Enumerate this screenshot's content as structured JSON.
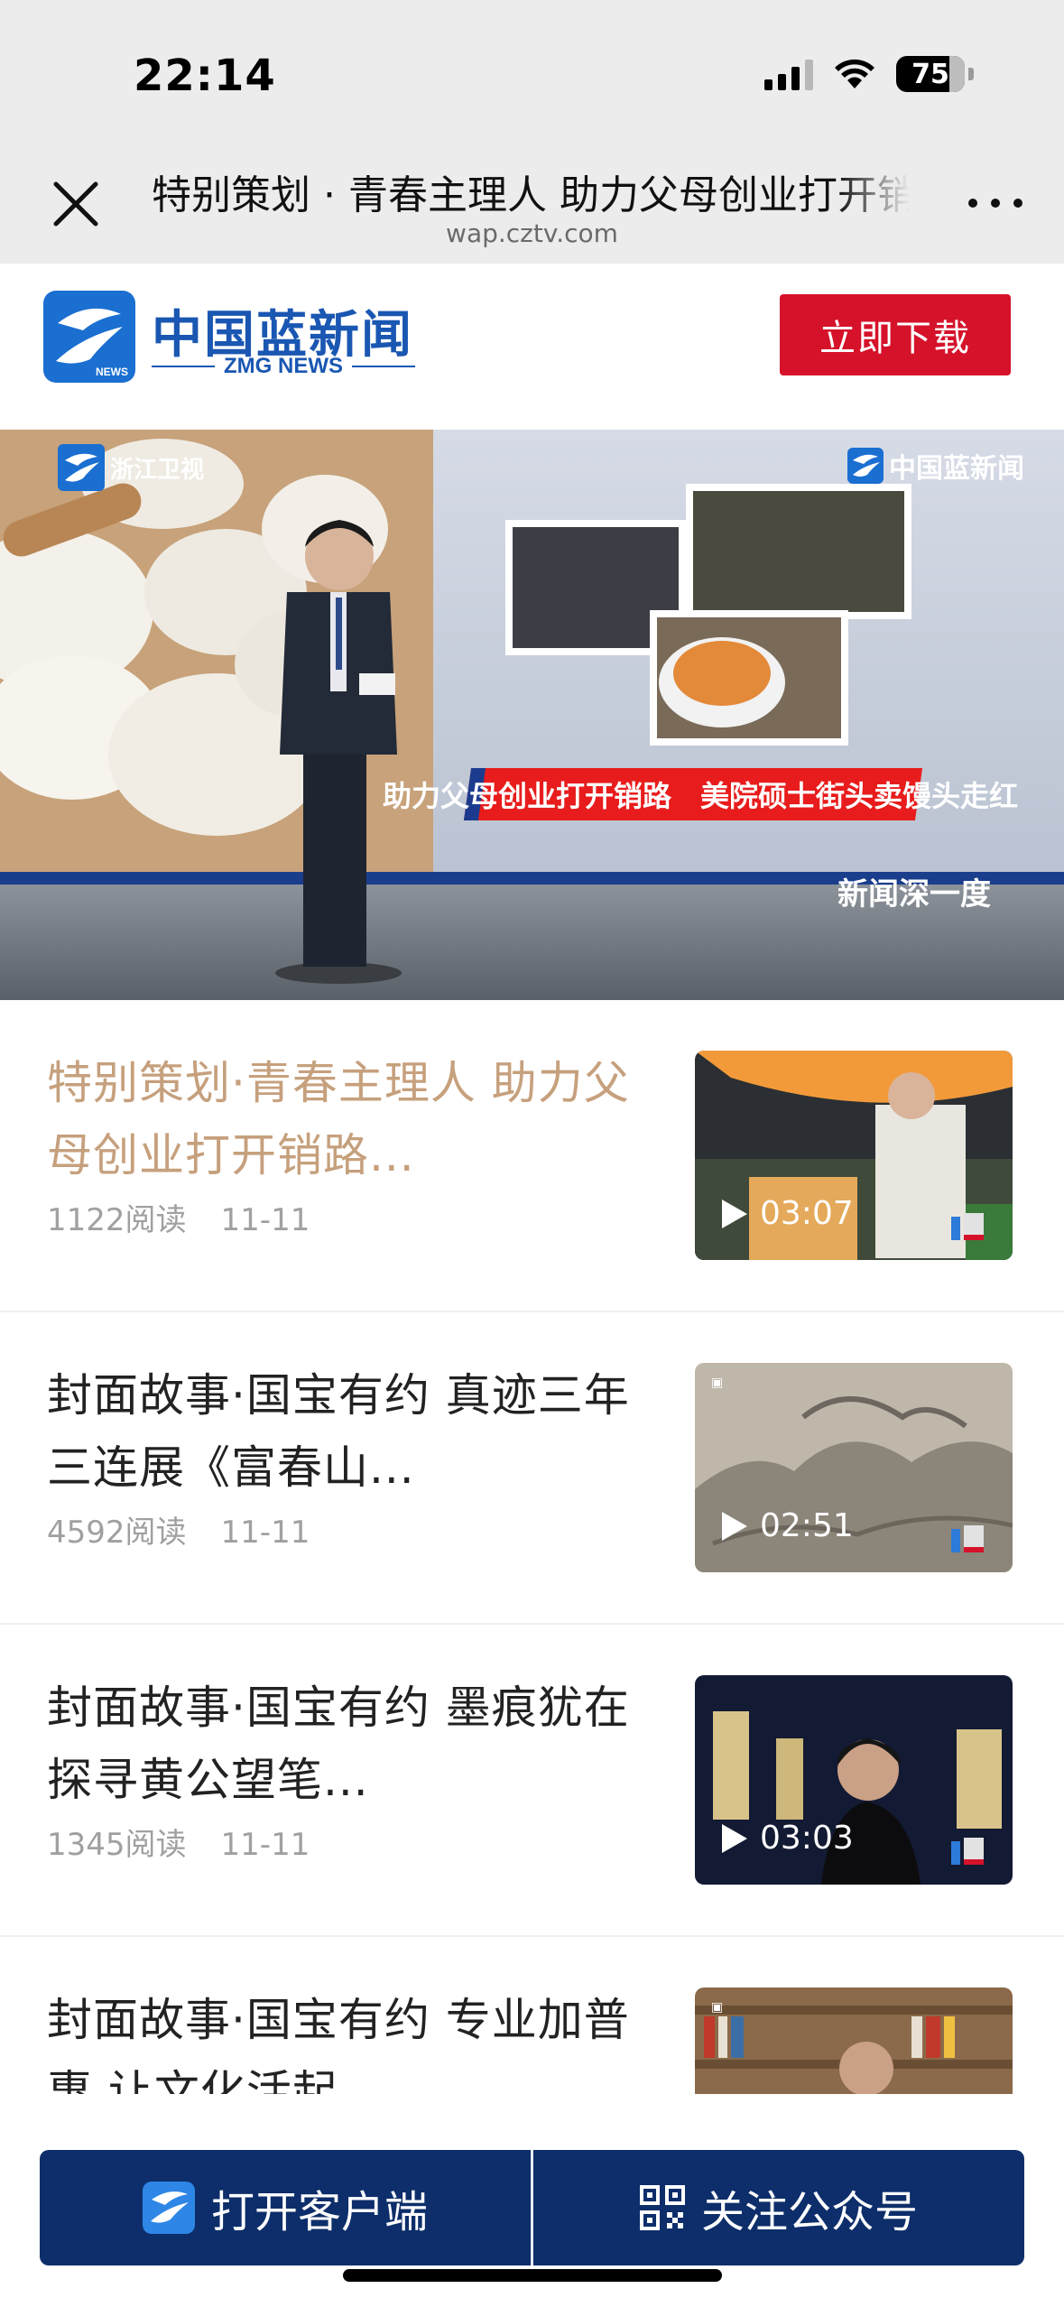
{
  "status_bar": {
    "time": "22:14",
    "battery": "75"
  },
  "browser": {
    "title": "特别策划 · 青春主理人 助力父母创业打开销路",
    "url": "wap.cztv.com"
  },
  "app_banner": {
    "logo_text": "中国蓝新闻",
    "logo_sub": "ZMG NEWS",
    "download_label": "立即下载"
  },
  "hero": {
    "watermark_left": "浙江卫视",
    "watermark_right": "中国蓝新闻",
    "caption": "助力父母创业打开销路　美院硕士街头卖馒头走红",
    "badge": "新闻深一度"
  },
  "articles": [
    {
      "title": "特别策划·青春主理人 助力父母创业打开销路...",
      "reads": "1122阅读",
      "date": "11-11",
      "duration": "03:07",
      "active": true
    },
    {
      "title": "封面故事·国宝有约 真迹三年三连展《富春山...",
      "reads": "4592阅读",
      "date": "11-11",
      "duration": "02:51",
      "active": false
    },
    {
      "title": "封面故事·国宝有约 墨痕犹在 探寻黄公望笔...",
      "reads": "1345阅读",
      "date": "11-11",
      "duration": "03:03",
      "active": false
    },
    {
      "title": "封面故事·国宝有约 专业加普惠 让文化活起",
      "reads": "",
      "date": "",
      "duration": "",
      "active": false
    }
  ],
  "bottom": {
    "open_app_label": "打开客户端",
    "follow_label": "关注公众号"
  },
  "colors": {
    "accent_red": "#d5122a",
    "brand_blue": "#1a57b2",
    "bottom_navy": "#0d2e6a",
    "active_title": "#c6a07d"
  }
}
